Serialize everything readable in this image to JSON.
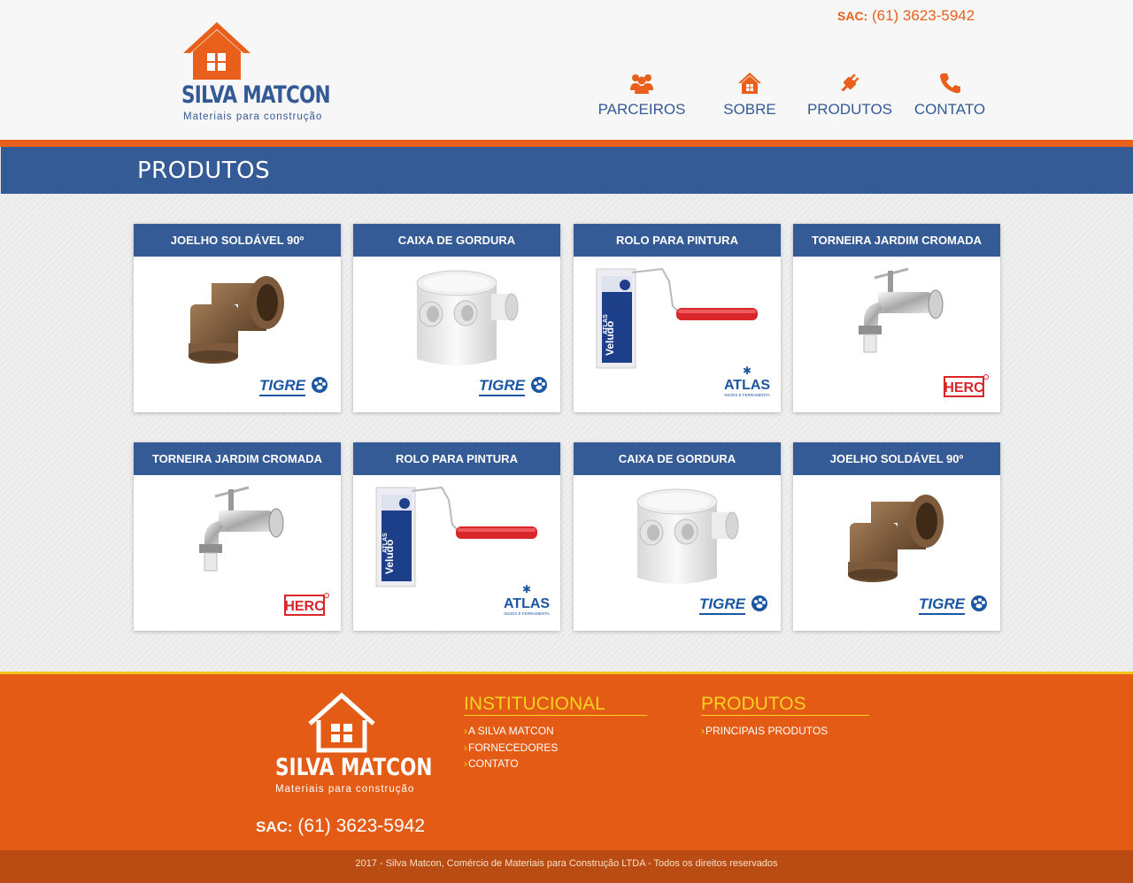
{
  "header": {
    "sac_label": "SAC:",
    "sac_phone": "(61) 3623-5942",
    "logo_name": "SILVA MATCON",
    "logo_tagline": "Materiais para construção",
    "nav": [
      {
        "label": "PARCEIROS",
        "icon": "people-icon"
      },
      {
        "label": "SOBRE",
        "icon": "house-icon"
      },
      {
        "label": "PRODUTOS",
        "icon": "plug-icon"
      },
      {
        "label": "CONTATO",
        "icon": "phone-icon"
      }
    ]
  },
  "page_title": "PRODUTOS",
  "products": [
    {
      "title": "JOELHO SOLDÁVEL 90º",
      "image": "elbow-pipe",
      "brand": "TIGRE"
    },
    {
      "title": "CAIXA DE GORDURA",
      "image": "grease-box",
      "brand": "TIGRE"
    },
    {
      "title": "ROLO PARA PINTURA",
      "image": "paint-roller",
      "brand": "ATLAS"
    },
    {
      "title": "TORNEIRA JARDIM CROMADA",
      "image": "faucet",
      "brand": "HERC"
    },
    {
      "title": "TORNEIRA JARDIM CROMADA",
      "image": "faucet",
      "brand": "HERC"
    },
    {
      "title": "ROLO PARA PINTURA",
      "image": "paint-roller",
      "brand": "ATLAS"
    },
    {
      "title": "CAIXA DE GORDURA",
      "image": "grease-box",
      "brand": "TIGRE"
    },
    {
      "title": "JOELHO SOLDÁVEL 90º",
      "image": "elbow-pipe",
      "brand": "TIGRE"
    }
  ],
  "brand_text": {
    "TIGRE": "TIGRE",
    "ATLAS": "ATLAS",
    "ATLAS_sub": "PINCÉIS E FERRAMENTAS",
    "HERC": "HERC",
    "roller_label": "Veludo"
  },
  "footer": {
    "logo_name": "SILVA MATCON",
    "logo_tagline": "Materiais para construção",
    "sac_label": "SAC:",
    "sac_phone": "(61) 3623-5942",
    "institucional": {
      "heading": "INSTITUCIONAL",
      "links": [
        "A SILVA MATCON",
        "FORNECEDORES",
        "CONTATO"
      ]
    },
    "produtos": {
      "heading": "PRODUTOS",
      "links": [
        "PRINCIPAIS PRODUTOS"
      ]
    },
    "copyright": "2017 - Silva Matcon, Comércio de Materiais para Construção LTDA - Todos os direitos reservados"
  },
  "colors": {
    "blue": "#345b95",
    "orange": "#e8601c",
    "yellow": "#f6d322"
  }
}
